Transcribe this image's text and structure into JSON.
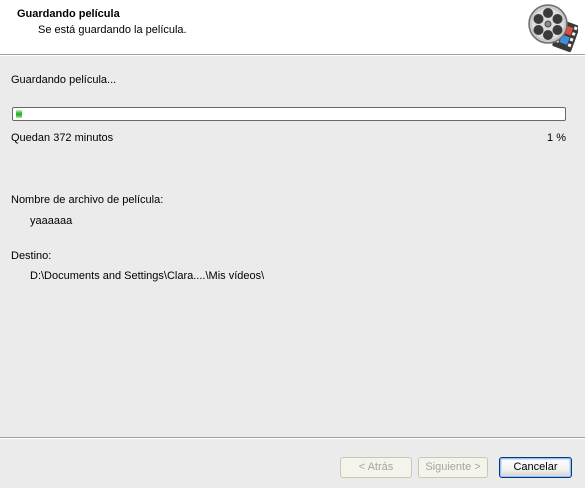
{
  "header": {
    "title": "Guardando película",
    "subtitle": "Se está guardando la película.",
    "icon": "film-reel-icon"
  },
  "progress": {
    "status_label": "Guardando película...",
    "remaining_text": "Quedan 372 minutos",
    "percent_text": "1 %",
    "percent": 1
  },
  "file": {
    "name_label": "Nombre de archivo de película:",
    "name_value": "yaaaaaa"
  },
  "destination": {
    "label": "Destino:",
    "value": "D:\\Documents and Settings\\Clara....\\Mis vídeos\\"
  },
  "buttons": {
    "back": "< Atrás",
    "next": "Siguiente >",
    "cancel": "Cancelar"
  },
  "colors": {
    "progress_fill": "#2fa82f",
    "dialog_bg": "#ebebeb",
    "header_bg": "#ffffff"
  }
}
